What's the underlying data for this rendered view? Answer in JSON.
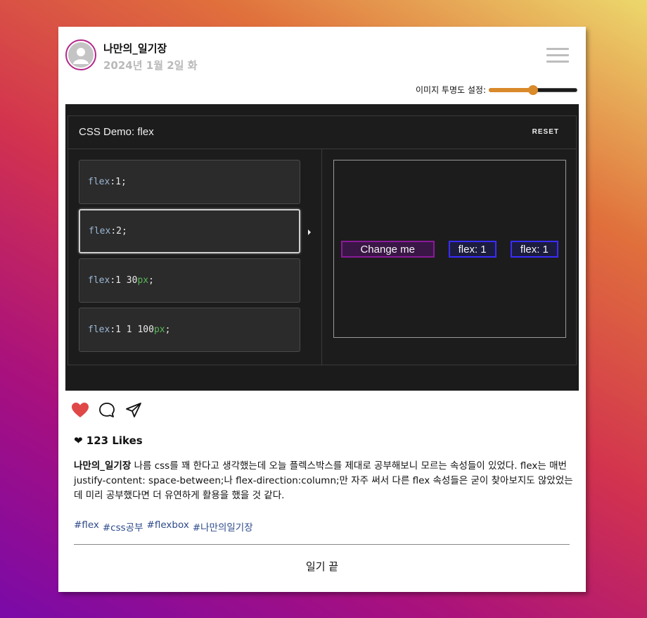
{
  "header": {
    "username": "나만의_일기장",
    "date": "2024년 1월 2일 화"
  },
  "opacity": {
    "label": "이미지 투명도 설정:",
    "value_fraction": 0.5,
    "accent_color": "#d98a2a"
  },
  "demo": {
    "title": "CSS Demo: flex",
    "reset_label": "RESET",
    "choices": [
      {
        "prop": "flex",
        "sep": ": ",
        "value": "1",
        "unit": "",
        "end": ";"
      },
      {
        "prop": "flex",
        "sep": ": ",
        "value": "2",
        "unit": "",
        "end": ";"
      },
      {
        "prop": "flex",
        "sep": ": ",
        "value": "1 30",
        "unit": "px",
        "end": ";"
      },
      {
        "prop": "flex",
        "sep": ": ",
        "value": "1 1 100",
        "unit": "px",
        "end": ";"
      }
    ],
    "selected_index": 1,
    "items": [
      "Change me",
      "flex: 1",
      "flex: 1"
    ]
  },
  "post": {
    "likes": "❤ 123 Likes",
    "caption_user": "나만의_일기장",
    "caption_text": " 나름 css를 꽤 한다고 생각했는데 오늘 플렉스박스를 제대로 공부해보니 모르는 속성들이 있었다. flex는 매번 justify-content: space-between;나 flex-direction:column;만 자주 써서 다른 flex 속성들은 굳이 찾아보지도 않았었는데 미리 공부했다면 더 유연하게 활용을 했을 것 같다.",
    "tags": [
      "#flex",
      "#css공부",
      "#flexbox",
      "#나만의일기장"
    ],
    "end_text": "일기 끝"
  },
  "icons": {
    "like": "heart-icon",
    "comment": "comment-icon",
    "share": "send-icon",
    "menu": "hamburger-menu-icon",
    "avatar": "user-avatar-icon"
  },
  "colors": {
    "heart": "#e04848",
    "tag": "#2d4a8a",
    "avatar_ring": "#b3288a"
  }
}
